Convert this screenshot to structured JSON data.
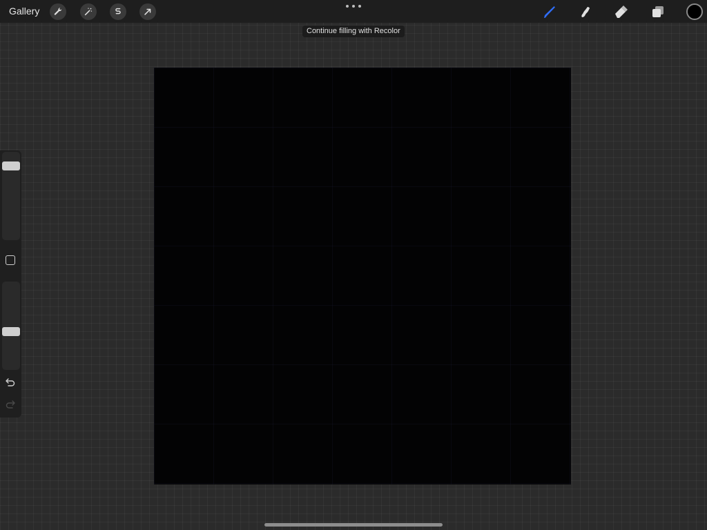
{
  "toolbar": {
    "gallery_label": "Gallery",
    "left_tools": [
      {
        "name": "actions",
        "icon": "wrench-icon"
      },
      {
        "name": "adjustments",
        "icon": "magic-wand-icon"
      },
      {
        "name": "selection",
        "icon": "selection-s-icon"
      },
      {
        "name": "transform",
        "icon": "arrow-cursor-icon"
      }
    ],
    "right_tools": [
      {
        "name": "brush",
        "icon": "brush-icon",
        "active": true
      },
      {
        "name": "smudge",
        "icon": "smudge-icon"
      },
      {
        "name": "eraser",
        "icon": "eraser-icon"
      },
      {
        "name": "layers",
        "icon": "layers-icon"
      }
    ],
    "active_color": "#000000",
    "accent_color": "#2f6df6"
  },
  "message": {
    "text": "Continue filling with Recolor"
  },
  "sidebar": {
    "brush_size_level": 0.0,
    "opacity_level": 0.4,
    "modify_icon": "square-icon",
    "undo_icon": "undo-icon",
    "redo_icon": "redo-icon"
  },
  "canvas": {
    "fill_color": "#030304"
  }
}
